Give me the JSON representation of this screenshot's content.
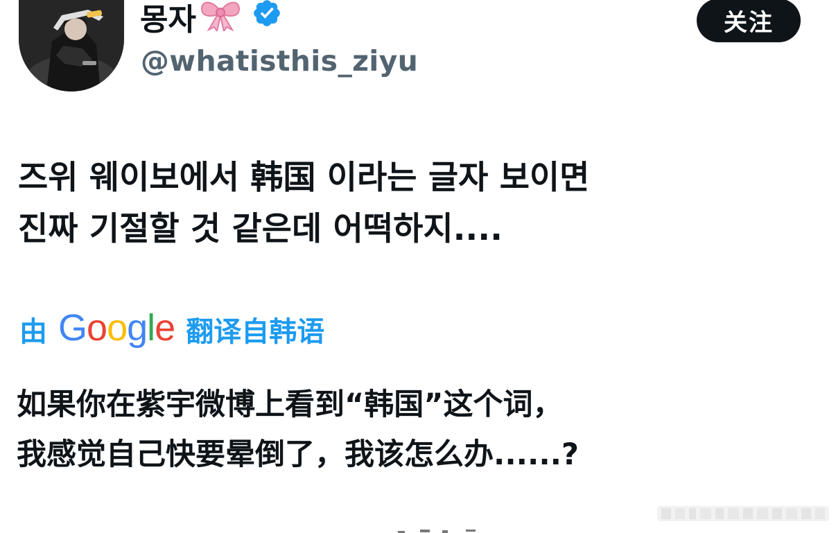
{
  "author": {
    "display_name": "몽자",
    "handle": "@whatisthis_ziyu",
    "avatar_icon": "profile-photo",
    "bow_icon": "ribbon-bow-emoji",
    "verified_icon": "verified-badge-icon"
  },
  "follow_button": {
    "label": "关注"
  },
  "tweet": {
    "lines": [
      "즈위 웨이보에서 韩国 이라는 글자 보이면",
      "진짜 기절할 것 같은데 어떡하지...."
    ]
  },
  "translation": {
    "prefix": "由",
    "provider": "Google",
    "suffix": "翻译自韩语",
    "lines": [
      "如果你在紫宇微博上看到“韩国”这个词，",
      "我感觉自己快要晕倒了，我该怎么办......?"
    ]
  },
  "colors": {
    "text_primary": "#0f1419",
    "text_secondary": "#536471",
    "link_blue": "#1d9bf0",
    "button_bg": "#0f1419",
    "google_blue": "#4285F4",
    "google_red": "#EA4335",
    "google_yellow": "#FBBC05",
    "google_green": "#34A853"
  }
}
